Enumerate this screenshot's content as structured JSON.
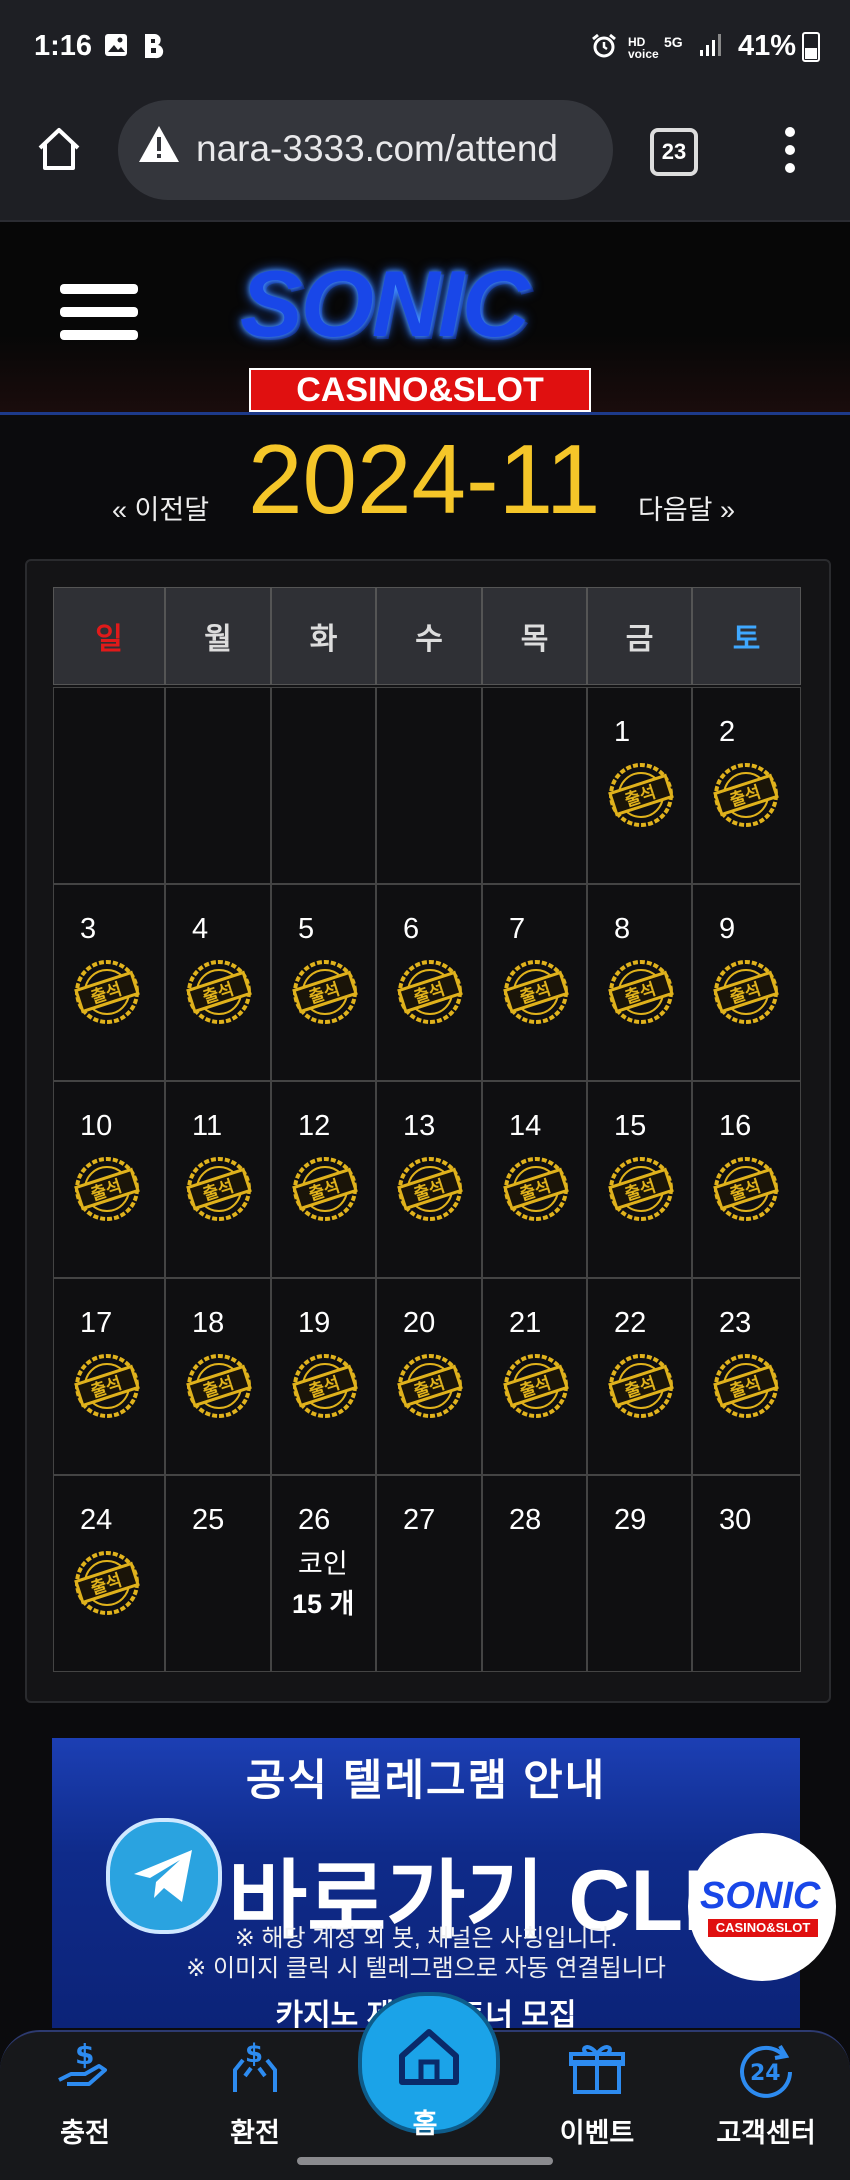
{
  "status_bar": {
    "time": "1:16",
    "indicators": [
      "HD voice",
      "5G"
    ],
    "battery": "41%"
  },
  "browser": {
    "url": "nara-3333.com/attend",
    "tab_count": "23"
  },
  "site": {
    "logo_word": "SONIC",
    "logo_sub": "CASINO&SLOT"
  },
  "month_nav": {
    "prev": "« 이전달",
    "current": "2024-11",
    "next": "다음달 »"
  },
  "calendar": {
    "weekdays": [
      "일",
      "월",
      "화",
      "수",
      "목",
      "금",
      "토"
    ],
    "weekday_colors": [
      "#e01a1a",
      "#dddddd",
      "#dddddd",
      "#dddddd",
      "#dddddd",
      "#dddddd",
      "#3fa8ff"
    ],
    "stamp_text": "출석",
    "weeks": [
      [
        {
          "d": ""
        },
        {
          "d": ""
        },
        {
          "d": ""
        },
        {
          "d": ""
        },
        {
          "d": ""
        },
        {
          "d": "1",
          "stamp": true
        },
        {
          "d": "2",
          "stamp": true
        }
      ],
      [
        {
          "d": "3",
          "stamp": true
        },
        {
          "d": "4",
          "stamp": true
        },
        {
          "d": "5",
          "stamp": true
        },
        {
          "d": "6",
          "stamp": true
        },
        {
          "d": "7",
          "stamp": true
        },
        {
          "d": "8",
          "stamp": true
        },
        {
          "d": "9",
          "stamp": true
        }
      ],
      [
        {
          "d": "10",
          "stamp": true
        },
        {
          "d": "11",
          "stamp": true
        },
        {
          "d": "12",
          "stamp": true
        },
        {
          "d": "13",
          "stamp": true
        },
        {
          "d": "14",
          "stamp": true
        },
        {
          "d": "15",
          "stamp": true
        },
        {
          "d": "16",
          "stamp": true
        }
      ],
      [
        {
          "d": "17",
          "stamp": true
        },
        {
          "d": "18",
          "stamp": true
        },
        {
          "d": "19",
          "stamp": true
        },
        {
          "d": "20",
          "stamp": true
        },
        {
          "d": "21",
          "stamp": true
        },
        {
          "d": "22",
          "stamp": true
        },
        {
          "d": "23",
          "stamp": true
        }
      ],
      [
        {
          "d": "24",
          "stamp": true
        },
        {
          "d": "25"
        },
        {
          "d": "26",
          "coin_label": "코인",
          "coin_count": "15 개"
        },
        {
          "d": "27"
        },
        {
          "d": "28"
        },
        {
          "d": "29"
        },
        {
          "d": "30"
        }
      ]
    ]
  },
  "banner": {
    "title": "공식 텔레그램 안내",
    "main": "바로가기 CLICK",
    "note1": "※ 해당 계정 외 봇, 채널은 사칭입니다.",
    "note2": "※ 이미지 클릭 시 텔레그램으로 자동 연결됩니다",
    "note3": "카지노 제휴 파트너 모집"
  },
  "float_logo": {
    "word": "SONIC",
    "sub": "CASINO&SLOT"
  },
  "bottom_nav": {
    "deposit": "충전",
    "withdraw": "환전",
    "home": "홈",
    "event": "이벤트",
    "support": "고객센터"
  },
  "colors": {
    "accent_gold": "#f5c629",
    "nav_blue": "#1ba3e8",
    "brand_blue": "#1947e8",
    "brand_red": "#e01010"
  }
}
